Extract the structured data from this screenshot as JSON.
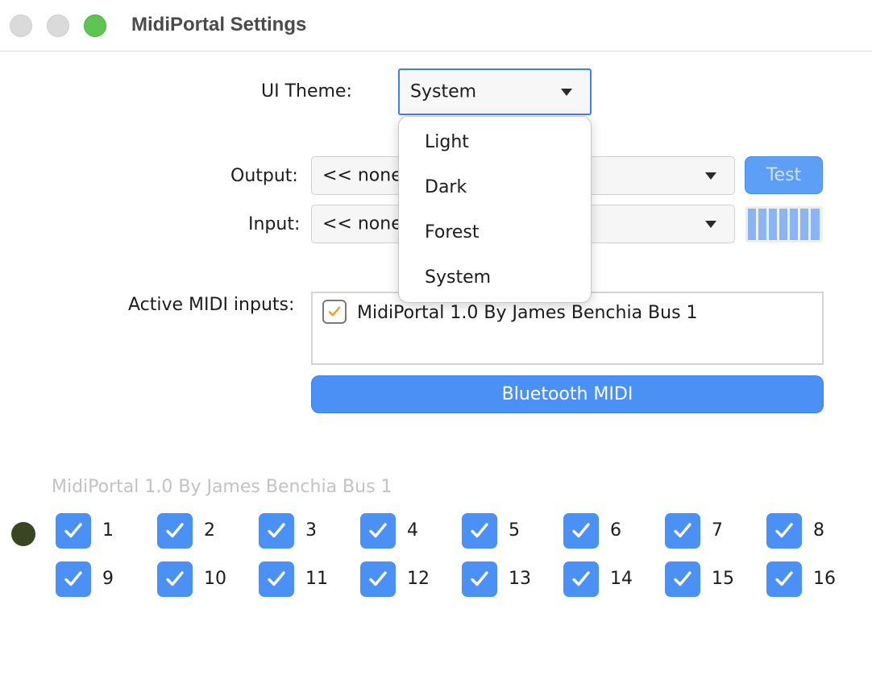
{
  "window": {
    "title": "MidiPortal Settings"
  },
  "theme": {
    "label": "UI Theme:",
    "selected": "System",
    "options": [
      "Light",
      "Dark",
      "Forest",
      "System"
    ]
  },
  "output": {
    "label": "Output:",
    "value": "<< none",
    "test_button": "Test"
  },
  "input": {
    "label": "Input:",
    "value": "<< none"
  },
  "active_inputs": {
    "label": "Active MIDI inputs:",
    "items": [
      {
        "name": "MidiPortal 1.0 By James Benchia Bus 1",
        "checked": true
      }
    ]
  },
  "bluetooth_button": "Bluetooth MIDI",
  "device": {
    "name": "MidiPortal 1.0 By James Benchia Bus 1",
    "channels": [
      "1",
      "2",
      "3",
      "4",
      "5",
      "6",
      "7",
      "8",
      "9",
      "10",
      "11",
      "12",
      "13",
      "14",
      "15",
      "16"
    ]
  },
  "colors": {
    "accent": "#4a90f5",
    "close": "#dadada",
    "maximize": "#5fc453",
    "led": "#3a4623",
    "checkmark_orange": "#f0a030"
  }
}
